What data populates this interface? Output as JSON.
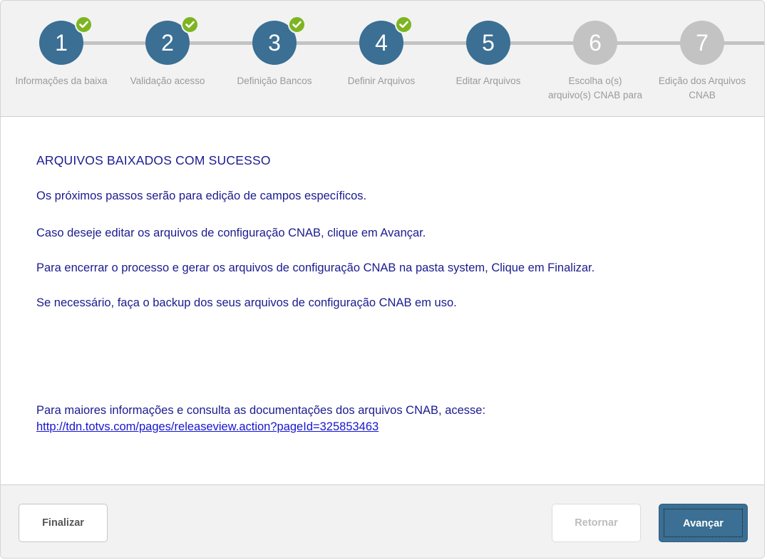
{
  "wizard": {
    "steps": [
      {
        "number": "1",
        "label": "Informações da baixa",
        "state": "done"
      },
      {
        "number": "2",
        "label": "Validação acesso",
        "state": "done"
      },
      {
        "number": "3",
        "label": "Definição Bancos",
        "state": "done"
      },
      {
        "number": "4",
        "label": "Definir Arquivos",
        "state": "done"
      },
      {
        "number": "5",
        "label": "Editar Arquivos",
        "state": "active"
      },
      {
        "number": "6",
        "label": "Escolha o(s) arquivo(s) CNAB para",
        "state": "pending"
      },
      {
        "number": "7",
        "label": "Edição dos Arquivos CNAB",
        "state": "pending"
      }
    ],
    "colors": {
      "done": "#3b6f94",
      "pending": "#c3c3c3",
      "check": "#7cb521"
    },
    "check_icon": "checkmark-icon"
  },
  "content": {
    "heading": "ARQUIVOS BAIXADOS COM SUCESSO",
    "line1": "Os próximos passos serão para edição de campos específicos.",
    "line2": "Caso deseje editar os arquivos de configuração CNAB, clique em Avançar.",
    "line3": "Para encerrar o processo e gerar os arquivos de configuração CNAB na pasta system, Clique em Finalizar.",
    "line4": "Se necessário, faça o backup dos seus arquivos de configuração CNAB em uso.",
    "more_info": "Para maiores informações e consulta as documentações dos arquivos CNAB, acesse:",
    "link": "http://tdn.totvs.com/pages/releaseview.action?pageId=325853463",
    "text_color": "#1b1b8f",
    "link_color": "#1515cf"
  },
  "footer": {
    "finalizar_label": "Finalizar",
    "retornar_label": "Retornar",
    "avancar_label": "Avançar"
  }
}
